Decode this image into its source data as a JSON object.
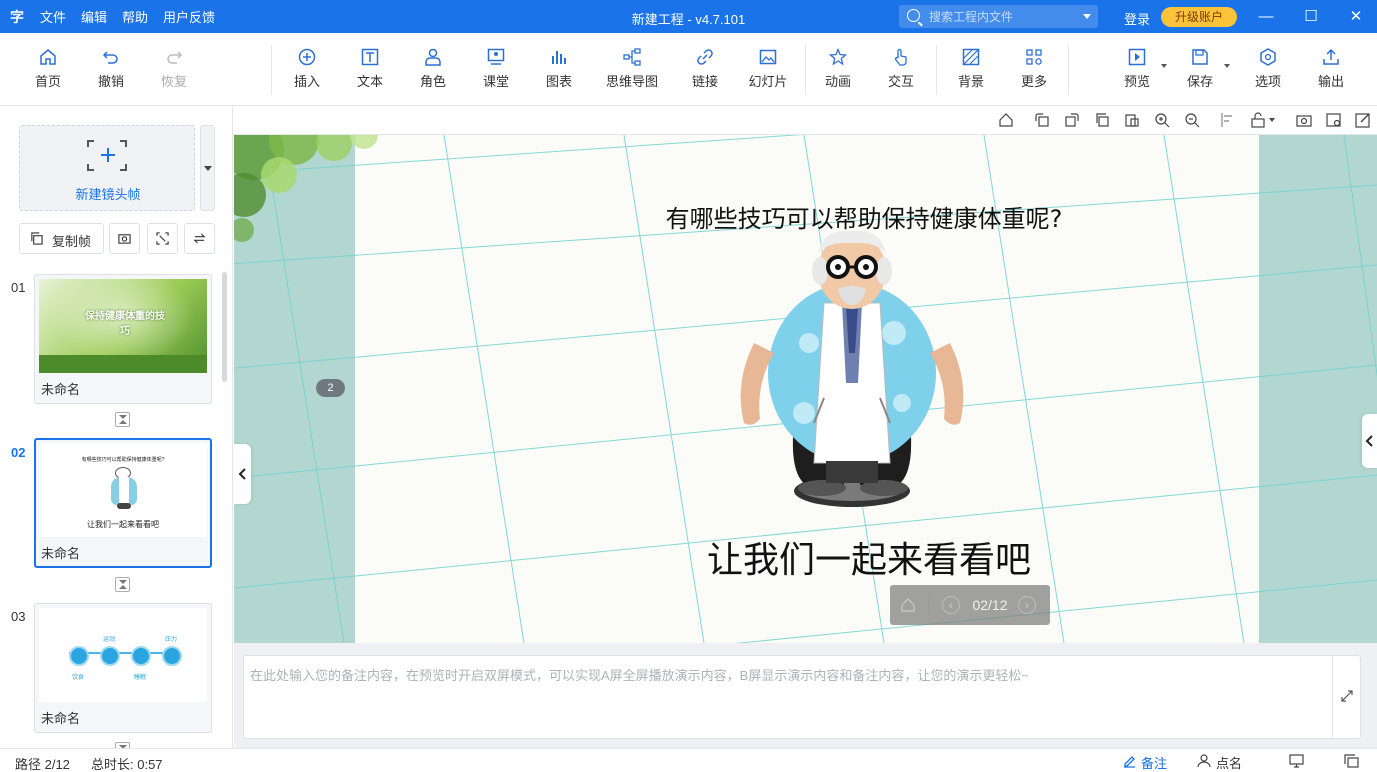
{
  "titlebar": {
    "logo": "字",
    "menus": [
      "文件",
      "编辑",
      "帮助",
      "用户反馈"
    ],
    "title": "新建工程 - v4.7.101",
    "search_placeholder": "搜索工程内文件",
    "login": "登录",
    "upgrade": "升级账户",
    "minimize": "—",
    "maximize": "☐",
    "close": "✕"
  },
  "toolbar": {
    "home": "首页",
    "undo": "撤销",
    "redo": "恢复",
    "insert": "插入",
    "text": "文本",
    "role": "角色",
    "classroom": "课堂",
    "chart": "图表",
    "mindmap": "思维导图",
    "link": "链接",
    "slide": "幻灯片",
    "animation": "动画",
    "interaction": "交互",
    "background": "背景",
    "more": "更多",
    "preview": "预览",
    "save": "保存",
    "options": "选项",
    "export": "输出"
  },
  "leftpanel": {
    "new_frame": "新建镜头帧",
    "copy_frame": "复制帧",
    "slides": [
      {
        "num": "01",
        "name": "未命名",
        "thumb_title": "保持健康体重的技巧"
      },
      {
        "num": "02",
        "name": "未命名",
        "thumb_q": "有哪些技巧可以帮助保持健康体重呢?",
        "thumb_sub": "让我们一起来看看吧"
      },
      {
        "num": "03",
        "name": "未命名",
        "thumb_labels": [
          "饮食",
          "运动",
          "睡眠",
          "压力"
        ]
      }
    ]
  },
  "stage": {
    "question": "有哪些技巧可以帮助保持健康体重呢?",
    "subtitle": "让我们一起来看看吧",
    "badge": "2",
    "pager": "02/12"
  },
  "notes": {
    "placeholder": "在此处输入您的备注内容，在预览时开启双屏模式，可以实现A屏全屏播放演示内容，B屏显示演示内容和备注内容，让您的演示更轻松~"
  },
  "statusbar": {
    "path": "路径 2/12",
    "duration": "总时长: 0:57",
    "notes": "备注",
    "rollcall": "点名"
  },
  "colors": {
    "accent": "#1a73e8",
    "upgrade": "#f9c43a",
    "stage_side": "#b2d7d0"
  }
}
